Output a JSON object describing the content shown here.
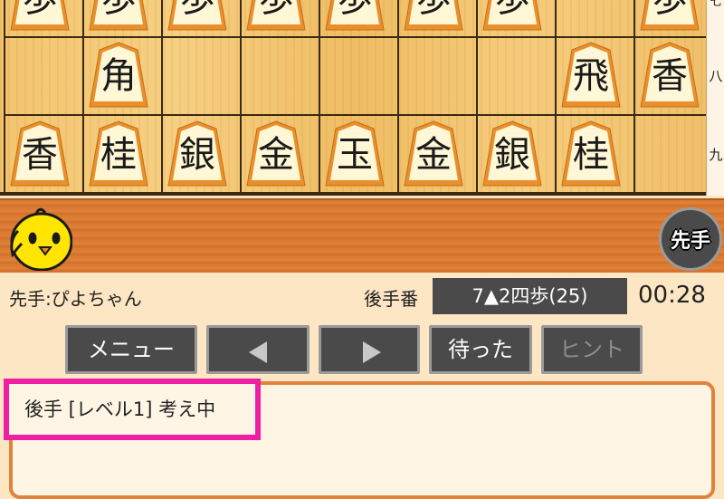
{
  "board": {
    "rank_labels": [
      "八",
      "九"
    ],
    "pawn_row_files": [
      0,
      1,
      2,
      3,
      4,
      5,
      6,
      8
    ],
    "rank8": [
      {
        "file": 1,
        "char": "角"
      },
      {
        "file": 7,
        "char": "飛"
      },
      {
        "file": 8,
        "char": "香"
      }
    ],
    "rank9": [
      {
        "file": 0,
        "char": "香"
      },
      {
        "file": 1,
        "char": "桂"
      },
      {
        "file": 2,
        "char": "銀"
      },
      {
        "file": 3,
        "char": "金"
      },
      {
        "file": 4,
        "char": "玉"
      },
      {
        "file": 5,
        "char": "金"
      },
      {
        "file": 6,
        "char": "銀"
      },
      {
        "file": 7,
        "char": "桂"
      }
    ]
  },
  "hand": {
    "turn_badge": "先手",
    "avatar_icon": "chick-icon"
  },
  "info": {
    "player_name": "先手:ぴよちゃん",
    "turn_label": "後手番",
    "last_move": "7▲2四歩(25)",
    "timer": "00:28"
  },
  "buttons": {
    "menu": "メニュー",
    "prev_icon": "triangle-left-icon",
    "next_icon": "triangle-right-icon",
    "undo": "待った",
    "hint": "ヒント"
  },
  "status": {
    "text": "後手 [レベル1] 考え中"
  },
  "colors": {
    "highlight": "#ee1fa3",
    "panel_border": "#e0833a",
    "button_bg": "#4a4a4a"
  }
}
